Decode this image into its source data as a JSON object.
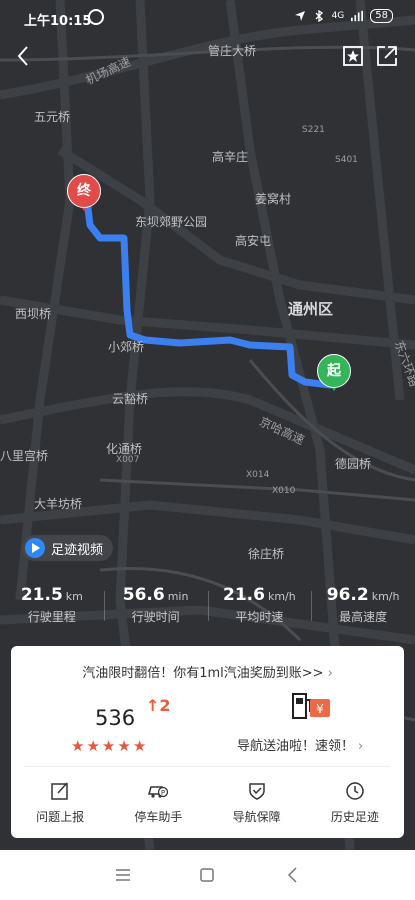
{
  "status_bar": {
    "time": "上午10:15",
    "signal": "4G",
    "battery": "58"
  },
  "map": {
    "labels": {
      "airport_expressway": "机场高速",
      "wudaokou": "五元桥",
      "guanzhuang": "管庄大桥",
      "gaoxinzhuang": "高辛庄",
      "dongba_park": "东坝郊野公园",
      "jiangcun": "姜窝村",
      "gaoanzhuang": "高安屯",
      "tongzhou": "通州区",
      "xierqi": "西坝桥",
      "xiaojiaqiao": "小郊桥",
      "yunzhuang": "云豁桥",
      "huayuanqiao": "化通桥",
      "bajiaocun": "八里宫桥",
      "dayangfang": "大羊坊桥",
      "jinghaxpwy": "京哈高速",
      "deyuan": "德园桥",
      "xuhuiqiao": "徐庄桥",
      "x014": "X014",
      "x010": "X010",
      "x007": "X007",
      "dongliuhuan": "东六环路",
      "s221": "S221",
      "s401": "S401"
    },
    "start_pin": "起",
    "end_pin": "终",
    "route_color": "#3b7ff0",
    "start_color": "#35b55a",
    "end_color": "#e34a4a"
  },
  "video_button": "足迹视频",
  "stats": [
    {
      "value": "21.5",
      "unit": "km",
      "label": "行驶里程"
    },
    {
      "value": "56.6",
      "unit": "min",
      "label": "行驶时间"
    },
    {
      "value": "21.6",
      "unit": "km/h",
      "label": "平均时速"
    },
    {
      "value": "96.2",
      "unit": "km/h",
      "label": "最高速度"
    }
  ],
  "card": {
    "promo": "汽油限时翻倍！你有1ml汽油奖励到账>>",
    "score": "536",
    "score_up": "2",
    "stars": 5,
    "fuel_text": "导航送油啦！速领！",
    "tools": [
      {
        "icon": "report-icon",
        "label": "问题上报"
      },
      {
        "icon": "parking-icon",
        "label": "停车助手"
      },
      {
        "icon": "shield-icon",
        "label": "导航保障"
      },
      {
        "icon": "clock-icon",
        "label": "历史足迹"
      }
    ]
  },
  "colors": {
    "accent": "#ea5a3b",
    "video_play": "#2f88f5"
  }
}
